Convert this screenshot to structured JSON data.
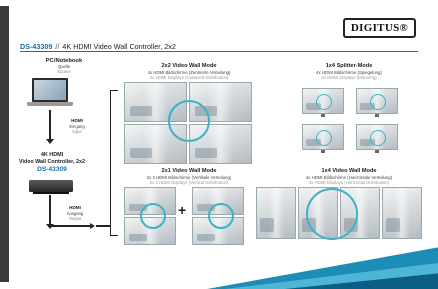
{
  "brand": {
    "logo": "DIGITUS®"
  },
  "heading": {
    "code": "DS-43309",
    "separator": "//",
    "title": "4K HDMI Video Wall Controller, 2x2"
  },
  "source": {
    "title": "PC/Notebook",
    "de": "Quelle",
    "en": "Source"
  },
  "input": {
    "title": "HDMI",
    "de": "Eingang",
    "en": "Input"
  },
  "controller": {
    "line1": "4K HDMI",
    "line2": "Video Wall Controller, 2x2",
    "code": "DS-43309"
  },
  "output": {
    "title": "HDMI",
    "de": "Ausgang",
    "en": "Output"
  },
  "modes": [
    {
      "title": "2x2 Video Wall Mode",
      "de": "4x HDMI Bildschirme (Zentrierte Verteilung)",
      "en": "4x HDMI Displays (Centered Distribution)"
    },
    {
      "title": "1x4 Splitter-Mode",
      "de": "4x HDMI Bildschirme (Spiegelung)",
      "en": "4x HDMI Displays (Mirroring)"
    },
    {
      "title": "2x1 Video Wall Mode",
      "de": "2x 2 HDMI Bildschirme (Vertikale Verteilung)",
      "en": "2x 2 HDMI Displays (Vertical Distribution)"
    },
    {
      "title": "1x4 Video Wall Mode",
      "de": "4x HDMI Bildschirme (Horizontale Verteilung)",
      "en": "4x HDMI Displays (Horizontal Distribution)"
    }
  ],
  "symbols": {
    "plus": "+"
  },
  "colors": {
    "accent": "#1b6fa8",
    "ring": "#3bb3c3",
    "wave": "#1c8db6"
  },
  "icons": [
    "laptop-icon",
    "arrow-down-icon",
    "device-icon",
    "monitor-icon"
  ]
}
